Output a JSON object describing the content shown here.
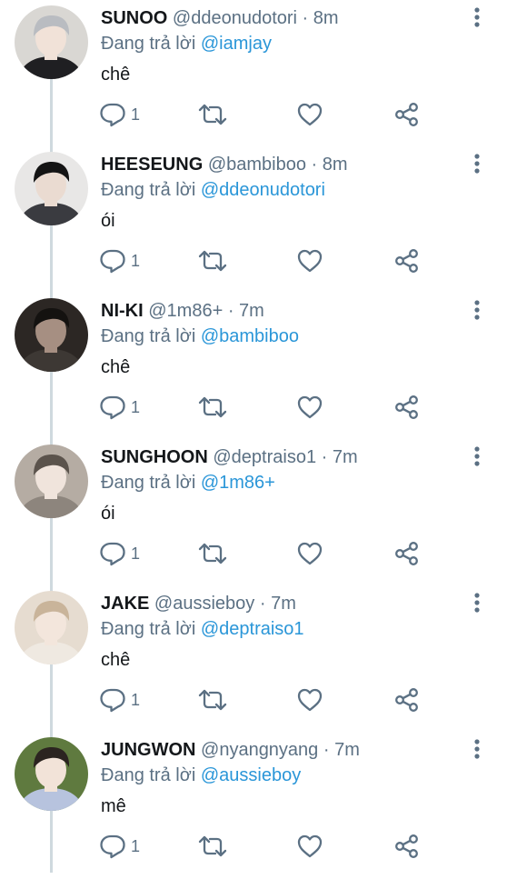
{
  "reply_prefix": "Đang trả lời",
  "tweets": [
    {
      "name": "SUNOO",
      "handle": "@ddeonudotori",
      "separator": "·",
      "time": "8m",
      "reply_to": "@iamjay",
      "text": "chê",
      "reply_count": "1",
      "avatar": {
        "bg": "#d9d7d3",
        "hair": "#b9bcc1",
        "skin": "#f1e2d8",
        "shirt": "#1f1f22"
      }
    },
    {
      "name": "HEESEUNG",
      "handle": "@bambiboo",
      "separator": "·",
      "time": "8m",
      "reply_to": "@ddeonudotori",
      "text": "ói",
      "reply_count": "1",
      "avatar": {
        "bg": "#e8e7e6",
        "hair": "#141414",
        "skin": "#eadbd1",
        "shirt": "#3a3b40"
      }
    },
    {
      "name": "NI-KI",
      "handle": "@1m86+",
      "separator": "·",
      "time": "7m",
      "reply_to": "@bambiboo",
      "text": "chê",
      "reply_count": "1",
      "avatar": {
        "bg": "#2c2724",
        "hair": "#141210",
        "skin": "#a68f82",
        "shirt": "#3d3834"
      }
    },
    {
      "name": "SUNGHOON",
      "handle": "@deptraiso1",
      "separator": "·",
      "time": "7m",
      "reply_to": "@1m86+",
      "text": "ói",
      "reply_count": "1",
      "avatar": {
        "bg": "#b5aca3",
        "hair": "#5b534c",
        "skin": "#f0e4dc",
        "shirt": "#8d857d"
      }
    },
    {
      "name": "JAKE",
      "handle": "@aussieboy",
      "separator": "·",
      "time": "7m",
      "reply_to": "@deptraiso1",
      "text": "chê",
      "reply_count": "1",
      "avatar": {
        "bg": "#e6dcd0",
        "hair": "#c9b49a",
        "skin": "#f3e6dc",
        "shirt": "#efe9e1"
      }
    },
    {
      "name": "JUNGWON",
      "handle": "@nyangnyang",
      "separator": "·",
      "time": "7m",
      "reply_to": "@aussieboy",
      "text": "mê",
      "reply_count": "1",
      "avatar": {
        "bg": "#5f7a3f",
        "hair": "#2b2420",
        "skin": "#f2e3d8",
        "shirt": "#b7c3de"
      }
    }
  ],
  "colors": {
    "name": "#14171a",
    "secondary": "#5b7083",
    "mention": "#2a96d8",
    "thread_line": "#cfd9de",
    "icon": "#5b7083"
  },
  "icons": {
    "reply": "reply-icon",
    "retweet": "retweet-icon",
    "like": "heart-icon",
    "share": "share-icon",
    "more": "more-vertical-icon"
  }
}
